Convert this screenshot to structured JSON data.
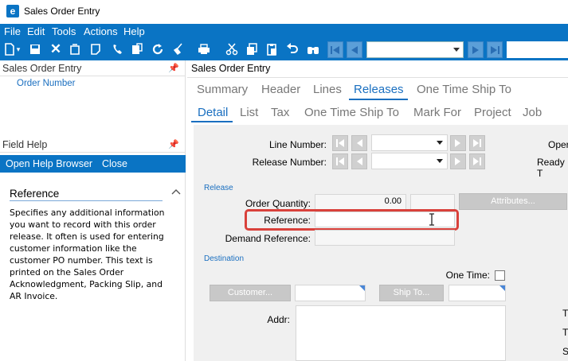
{
  "window": {
    "title": "Sales Order Entry",
    "app_icon": "e"
  },
  "menu": [
    "File",
    "Edit",
    "Tools",
    "Actions",
    "Help"
  ],
  "toolbar": {
    "icons": [
      "new-icon",
      "save-icon",
      "delete-icon",
      "attach-icon",
      "notes-icon",
      "phone-icon",
      "print-preview-icon",
      "export-icon",
      "refresh-icon",
      "clear-icon",
      "print-icon",
      "cut-icon",
      "copy-icon",
      "paste-icon",
      "undo-icon",
      "search-icon"
    ],
    "nav_combo_value": ""
  },
  "tree_panel": {
    "title": "Sales Order Entry",
    "items": [
      "Order Number"
    ]
  },
  "field_help": {
    "title": "Field Help",
    "links": [
      "Open Help Browser",
      "Close"
    ],
    "heading": "Reference",
    "body": "Specifies any additional information you want to record with this order release. It often is used for entering customer information like the customer PO number. This text is printed on the Sales Order Acknowledgment, Packing Slip, and AR Invoice."
  },
  "main": {
    "title": "Sales Order Entry",
    "tabs": [
      "Summary",
      "Header",
      "Lines",
      "Releases",
      "One Time Ship To"
    ],
    "active_tab": "Releases",
    "subtabs": [
      "Detail",
      "List",
      "Tax",
      "One Time Ship To",
      "Mark For",
      "Project",
      "Job"
    ],
    "active_subtab": "Detail"
  },
  "form": {
    "line_number_label": "Line Number:",
    "release_number_label": "Release Number:",
    "open_label": "Oper",
    "ready_label": "Ready T",
    "release_section": "Release",
    "order_quantity_label": "Order Quantity:",
    "order_quantity_value": "0.00",
    "attributes_button": "Attributes...",
    "reference_label": "Reference:",
    "reference_value": "",
    "demand_reference_label": "Demand Reference:",
    "destination_section": "Destination",
    "one_time_label": "One Time:",
    "customer_button": "Customer...",
    "ship_to_button": "Ship To...",
    "addr_label": "Addr:",
    "right_labels": [
      "T",
      "T",
      "S"
    ]
  },
  "colors": {
    "accent": "#0a74c4",
    "link": "#1a6fc0",
    "highlight": "#d9413b"
  }
}
